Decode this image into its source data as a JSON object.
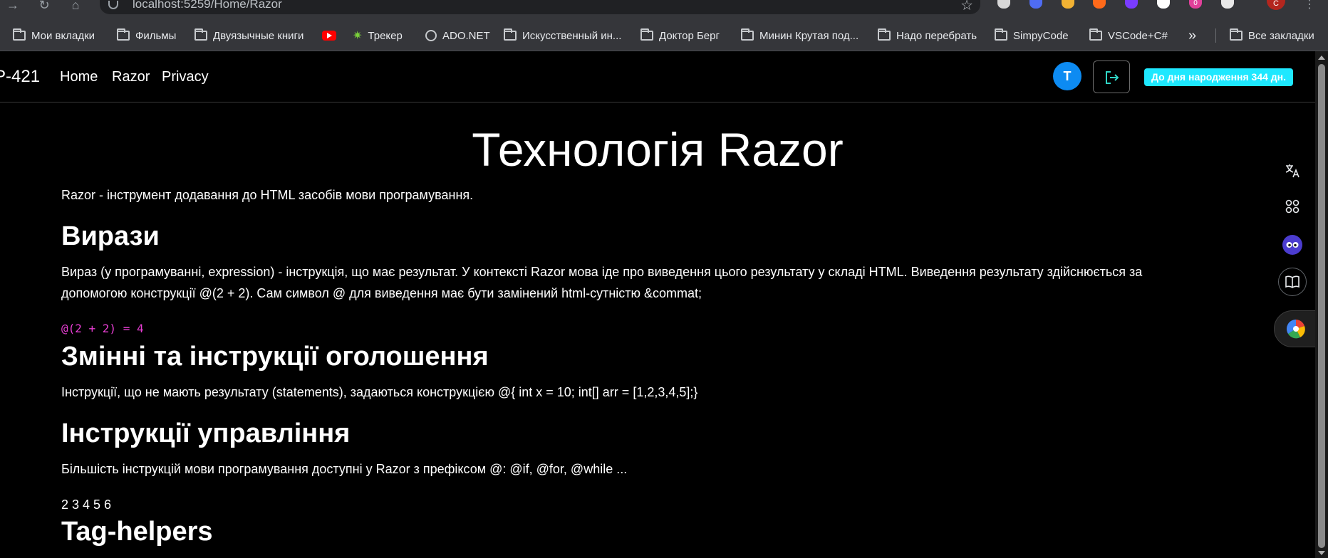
{
  "browser": {
    "url": "localhost:5259/Home/Razor",
    "profile_initial": "C",
    "extension_badge": "0",
    "bookmarks": [
      {
        "label": "Мои вкладки",
        "icon": "folder-icon"
      },
      {
        "label": "Фильмы",
        "icon": "folder-icon"
      },
      {
        "label": "Двуязычные книги",
        "icon": "folder-icon"
      },
      {
        "label": "",
        "icon": "youtube-icon"
      },
      {
        "label": "Трекер",
        "icon": "tracker-icon"
      },
      {
        "label": "ADO.NET",
        "icon": "globe-icon"
      },
      {
        "label": "Искусственный ин...",
        "icon": "folder-icon"
      },
      {
        "label": "Доктор Берг",
        "icon": "folder-icon"
      },
      {
        "label": "Минин Крутая под...",
        "icon": "folder-icon"
      },
      {
        "label": "Надо перебрать",
        "icon": "folder-icon"
      },
      {
        "label": "SimpyCode",
        "icon": "folder-icon"
      },
      {
        "label": "VSCode+C#",
        "icon": "folder-icon"
      }
    ],
    "overflow_chevron": "»",
    "all_bookmarks": "Все закладки"
  },
  "navbar": {
    "brand": "P-421",
    "links": [
      "Home",
      "Razor",
      "Privacy"
    ],
    "avatar_initial": "T",
    "birthday_badge": "До дня народження 344 дн."
  },
  "content": {
    "title": "Технологія Razor",
    "intro": "Razor - інструмент додавання до HTML засобів мови програмування.",
    "sections": [
      {
        "heading": "Вирази",
        "text": "Вираз (у програмуванні, expression) - інструкція, що має результат. У контексті Razor мова іде про виведення цього результату у складі HTML. Виведення результату здійснюється за допомогою конструкції @(2 + 2). Сам символ @ для виведення має бути замінений html-сутністю &commat;"
      },
      {
        "heading": "Змінні та інструкції оголошення",
        "text": "Інструкції, що не мають результату (statements), задаються конструкцією @{ int x = 10; int[] arr = [1,2,3,4,5];}"
      },
      {
        "heading": "Інструкції управління",
        "text": "Більшість інструкцій мови програмування доступні у Razor з префіксом @: @if, @for, @while ..."
      },
      {
        "heading": "Tag-helpers",
        "text": ""
      }
    ],
    "code_example": "@(2 + 2) = 4",
    "loop_output": "2 3 4 5 6"
  },
  "colors": {
    "background": "#000000",
    "accent_blue": "#0d8bf2",
    "badge_cyan": "#1ee8ff",
    "code_magenta": "#e83ed3",
    "logout_icon": "#2fd6c6"
  },
  "side_panel_icons": [
    "translate-icon",
    "apps-icon",
    "bot-icon",
    "reader-icon",
    "chrome-color-icon"
  ]
}
